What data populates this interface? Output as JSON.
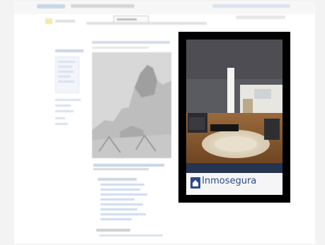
{
  "ad": {
    "label": "",
    "headline_line1": "",
    "headline_line2": "",
    "price_band": "",
    "brand": "Inmosegura",
    "tagline": ""
  },
  "colors": {
    "page_bg": "#f3f3f3",
    "ad_border": "#000000",
    "ad_band": "#25344f",
    "brand": "#2c4a86"
  },
  "icons": {
    "brand_mark": "house-logo-icon"
  }
}
